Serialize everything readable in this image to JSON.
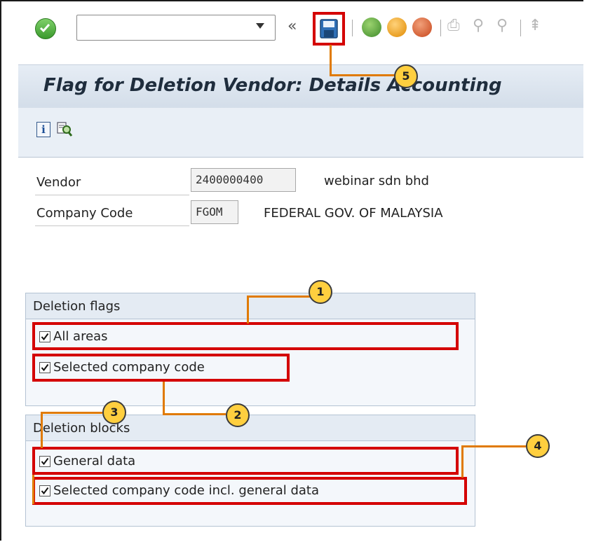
{
  "toolbar": {
    "command_value": "",
    "collapse_label": "«"
  },
  "title": "Flag for Deletion Vendor: Details Accounting",
  "fields": {
    "vendor_label": "Vendor",
    "vendor_value": "2400000400",
    "vendor_desc": "webinar sdn bhd",
    "company_label": "Company Code",
    "company_value": "FGOM",
    "company_desc": "FEDERAL GOV. OF MALAYSIA"
  },
  "deletion_flags": {
    "title": "Deletion flags",
    "items": [
      {
        "label": "All areas",
        "checked": true
      },
      {
        "label": "Selected company code",
        "checked": true
      }
    ]
  },
  "deletion_blocks": {
    "title": "Deletion blocks",
    "items": [
      {
        "label": "General data",
        "checked": true
      },
      {
        "label": "Selected company code incl. general data",
        "checked": true
      }
    ]
  },
  "callouts": [
    "1",
    "2",
    "3",
    "4",
    "5"
  ],
  "colors": {
    "highlight": "#d40000",
    "callout_fill": "#ffcf3f",
    "callout_line": "#e07a00",
    "title_text": "#1f2d3d"
  }
}
